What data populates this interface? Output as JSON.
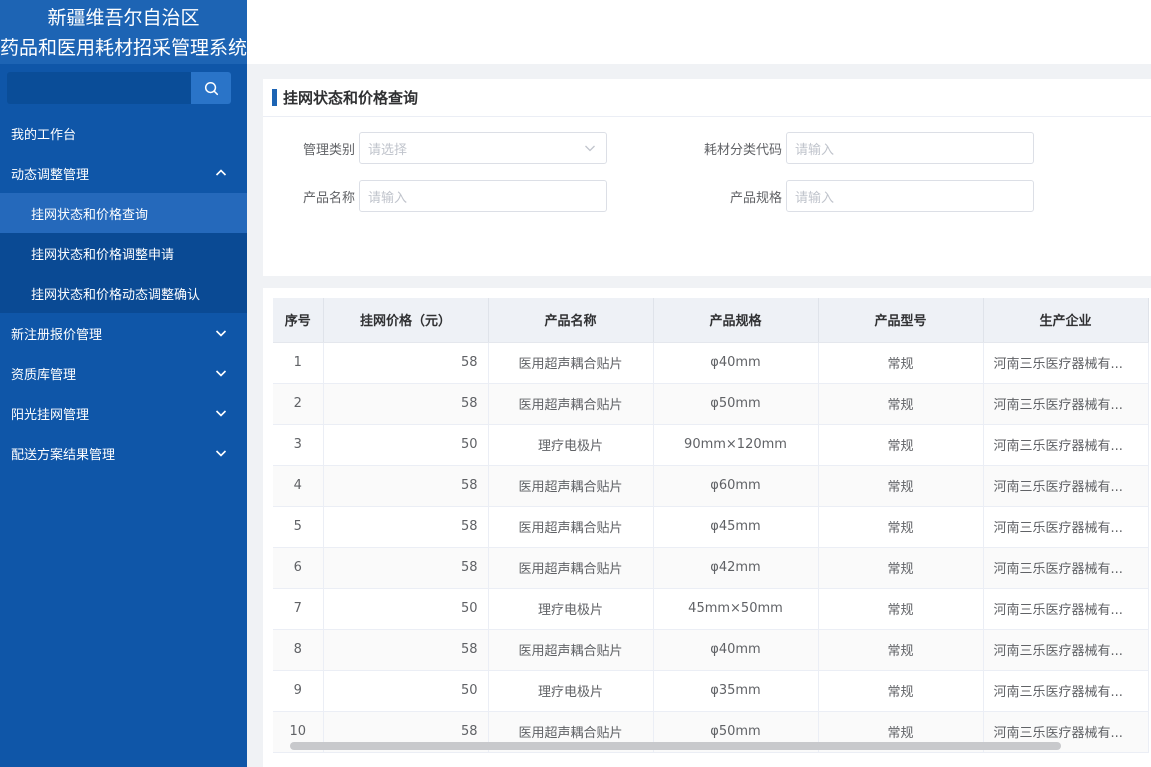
{
  "brand": {
    "line1": "新疆维吾尔自治区",
    "line2": "药品和医用耗材招采管理系统"
  },
  "sidebar": {
    "search_value": "",
    "items": [
      {
        "label": "我的工作台"
      },
      {
        "label": "动态调整管理"
      },
      {
        "label": "新注册报价管理"
      },
      {
        "label": "资质库管理"
      },
      {
        "label": "阳光挂网管理"
      },
      {
        "label": "配送方案结果管理"
      }
    ],
    "subitems": [
      {
        "label": "挂网状态和价格查询",
        "active": true
      },
      {
        "label": "挂网状态和价格调整申请"
      },
      {
        "label": "挂网状态和价格动态调整确认"
      }
    ]
  },
  "panel": {
    "title": "挂网状态和价格查询",
    "fields": {
      "category_label": "管理类别",
      "category_placeholder": "请选择",
      "code_label": "耗材分类代码",
      "code_placeholder": "请输入",
      "name_label": "产品名称",
      "name_placeholder": "请输入",
      "spec_label": "产品规格",
      "spec_placeholder": "请输入"
    }
  },
  "table": {
    "headers": [
      "序号",
      "挂网价格（元）",
      "产品名称",
      "产品规格",
      "产品型号",
      "生产企业"
    ],
    "rows": [
      [
        "1",
        "58",
        "医用超声耦合贴片",
        "φ40mm",
        "常规",
        "河南三乐医疗器械有..."
      ],
      [
        "2",
        "58",
        "医用超声耦合贴片",
        "φ50mm",
        "常规",
        "河南三乐医疗器械有..."
      ],
      [
        "3",
        "50",
        "理疗电极片",
        "90mm×120mm",
        "常规",
        "河南三乐医疗器械有..."
      ],
      [
        "4",
        "58",
        "医用超声耦合贴片",
        "φ60mm",
        "常规",
        "河南三乐医疗器械有..."
      ],
      [
        "5",
        "58",
        "医用超声耦合贴片",
        "φ45mm",
        "常规",
        "河南三乐医疗器械有..."
      ],
      [
        "6",
        "58",
        "医用超声耦合贴片",
        "φ42mm",
        "常规",
        "河南三乐医疗器械有..."
      ],
      [
        "7",
        "50",
        "理疗电极片",
        "45mm×50mm",
        "常规",
        "河南三乐医疗器械有..."
      ],
      [
        "8",
        "58",
        "医用超声耦合贴片",
        "φ40mm",
        "常规",
        "河南三乐医疗器械有..."
      ],
      [
        "9",
        "50",
        "理疗电极片",
        "φ35mm",
        "常规",
        "河南三乐医疗器械有..."
      ],
      [
        "10",
        "58",
        "医用超声耦合贴片",
        "φ50mm",
        "常规",
        "河南三乐医疗器械有..."
      ]
    ]
  },
  "colors": {
    "sidebar_bg": "#0f56a8",
    "brand_bg": "#1d64b4",
    "active_item_bg": "#2569bb",
    "accent": "#1d64b4"
  },
  "icons": {
    "search": "search-icon",
    "chevron_up": "chevron-up-icon",
    "chevron_down": "chevron-down-icon"
  }
}
